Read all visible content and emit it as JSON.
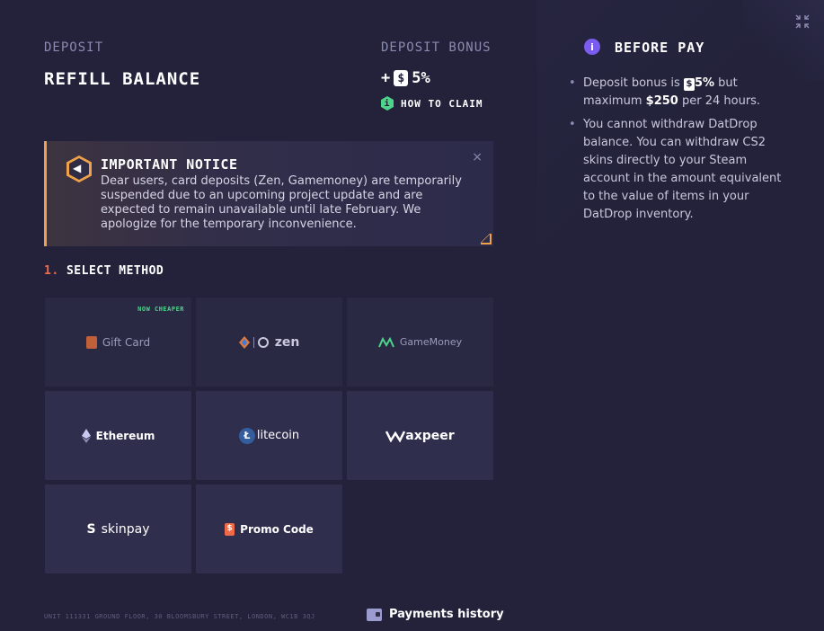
{
  "header": {
    "deposit_label": "DEPOSIT",
    "title": "REFILL BALANCE",
    "bonus_label": "DEPOSIT BONUS",
    "bonus_prefix": "+",
    "bonus_value": "5%",
    "how_to_claim": "HOW TO CLAIM"
  },
  "notice": {
    "title": "IMPORTANT NOTICE",
    "body": "Dear users, card deposits (Zen, Gamemoney) are temporarily suspended due to an upcoming project update and are expected to remain unavailable until late February. We apologize for the temporary inconvenience.",
    "close": "×"
  },
  "methods": {
    "step_number": "1.",
    "step_title": "SELECT METHOD",
    "items": [
      {
        "label": "Gift Card",
        "tag": "NOW CHEAPER",
        "icon": "gift-card-icon"
      },
      {
        "label": "zen",
        "icon": "zen-icon"
      },
      {
        "label": "GameMoney",
        "icon": "gamemoney-icon"
      },
      {
        "label": "Ethereum",
        "icon": "ethereum-icon"
      },
      {
        "label": "litecoin",
        "icon": "litecoin-icon"
      },
      {
        "label": "axpeer",
        "icon": "waxpeer-icon"
      },
      {
        "label": "skinpay",
        "icon": "skinpay-icon"
      },
      {
        "label": "Promo Code",
        "icon": "promo-code-icon"
      }
    ]
  },
  "footer": {
    "address": "UNIT 111331 GROUND FLOOR, 30 BLOOMSBURY STREET, LONDON, WC1B 3QJ",
    "payments_history": "Payments history"
  },
  "before_pay": {
    "title": "BEFORE PAY",
    "item1_a": "Deposit bonus is",
    "item1_bonus": "5%",
    "item1_b": "but maximum",
    "item1_max": "$250",
    "item1_c": "per 24 hours.",
    "item2": "You cannot withdraw DatDrop balance. You can withdraw CS2 skins directly to your Steam account in the amount equivalent to the value of items in your DatDrop inventory."
  },
  "colors": {
    "accent_orange": "#f0a24a",
    "accent_green": "#4cd48a",
    "accent_purple": "#7b5cf0",
    "step_red": "#f06a4a"
  }
}
